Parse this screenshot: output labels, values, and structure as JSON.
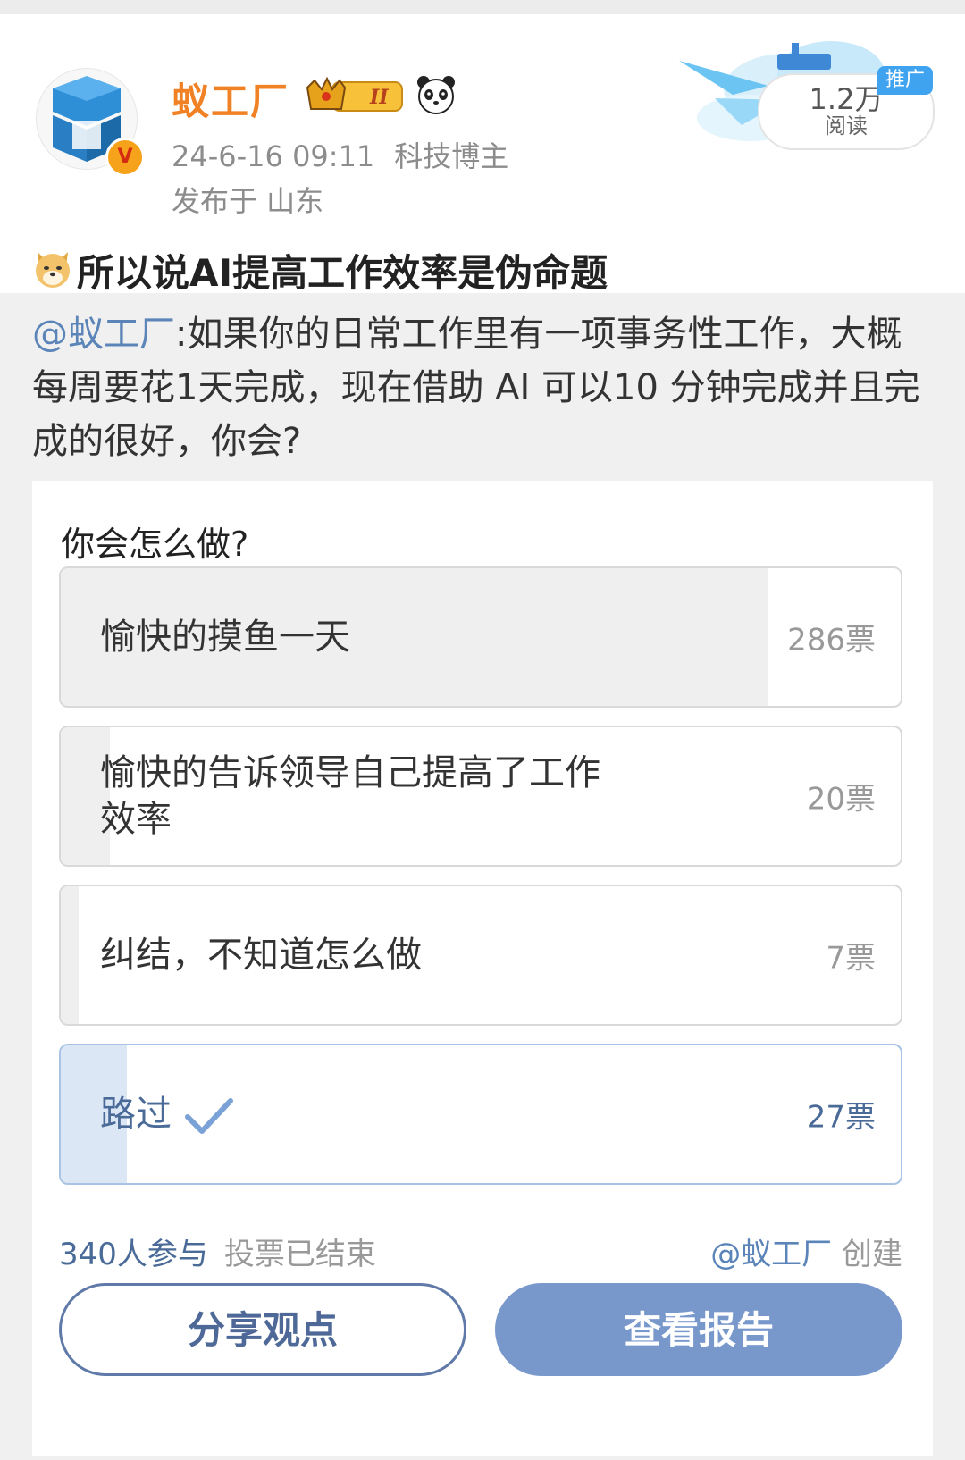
{
  "author": {
    "name": "蚁工厂",
    "level_badge": "II",
    "timestamp": "24-6-16 09:11",
    "role": "科技博主",
    "location": "发布于 山东"
  },
  "promo": {
    "read_count": "1.2万",
    "read_label": "阅读",
    "tag": "推广"
  },
  "post": {
    "title": "所以说AI提高工作效率是伪命题",
    "mention": "@蚁工厂",
    "quote_text": ":如果你的日常工作里有一项事务性工作，大概每周要花1天完成，现在借助 AI 可以10 分钟完成并且完成的很好，你会?"
  },
  "poll": {
    "question": "你会怎么做?",
    "options": [
      {
        "label": "愉快的摸鱼一天",
        "votes": "286票",
        "share": 0.841,
        "selected": false
      },
      {
        "label": "愉快的告诉领导自己提高了工作效率",
        "votes": "20票",
        "share": 0.059,
        "selected": false
      },
      {
        "label": "纠结，不知道怎么做",
        "votes": "7票",
        "share": 0.021,
        "selected": false
      },
      {
        "label": "路过",
        "votes": "27票",
        "share": 0.079,
        "selected": true
      }
    ],
    "participants": "340人参与",
    "status": "投票已结束",
    "creator_mention": "@蚁工厂",
    "creator_suffix": "创建",
    "share_button": "分享观点",
    "report_button": "查看报告"
  },
  "colors": {
    "author_name": "#f08225",
    "link": "#5b84b8",
    "selected_fill": "#dce7f6",
    "report_button": "#7898cc"
  },
  "icons": [
    "avatar-cube-icon",
    "verified-v-icon",
    "crown-level-icon",
    "panda-icon",
    "doge-icon",
    "checkmark-icon",
    "airplane-cloud-illustration"
  ]
}
